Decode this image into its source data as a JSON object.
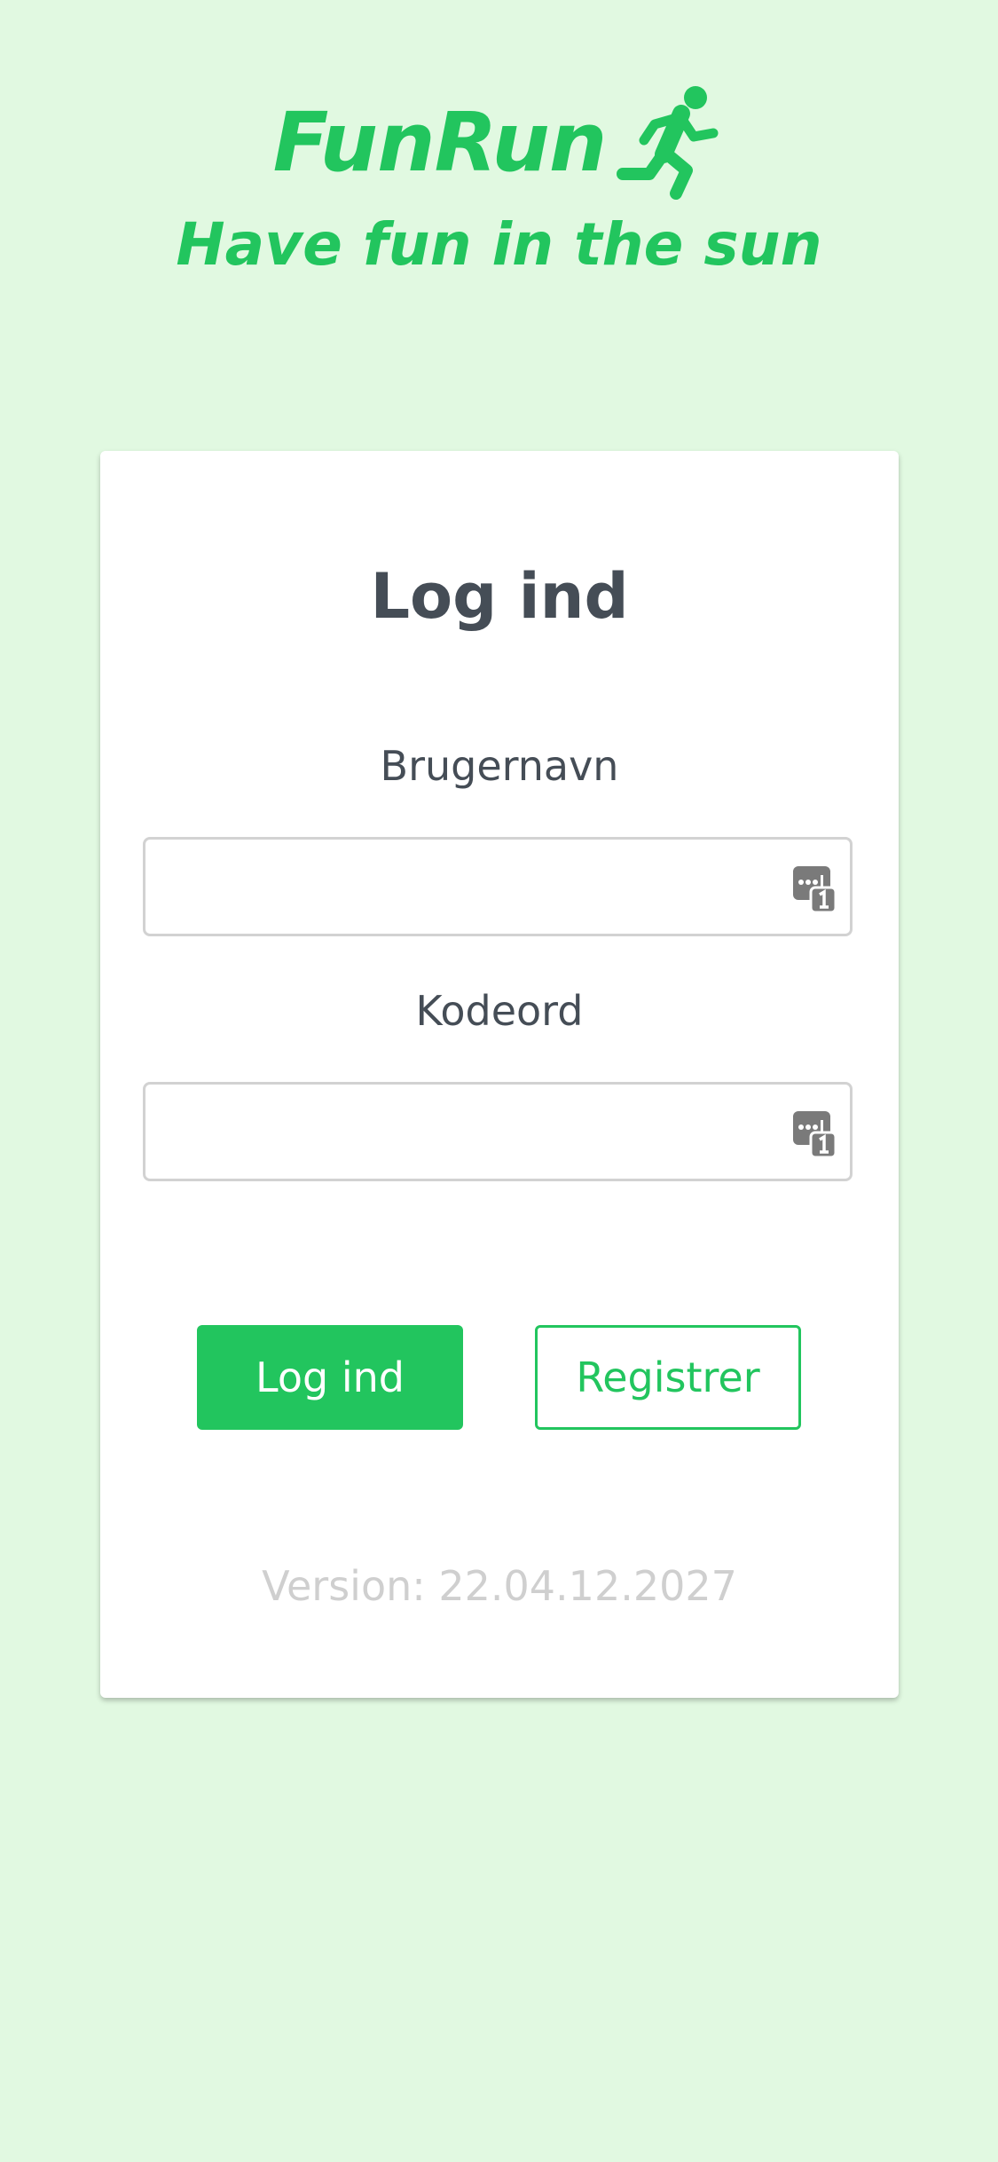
{
  "brand": {
    "name": "FunRun",
    "tagline": "Have fun in the sun",
    "color": "#22c55e",
    "icon": "running-person-icon"
  },
  "login_card": {
    "title": "Log ind",
    "username": {
      "label": "Brugernavn",
      "value": "",
      "placeholder": "",
      "icon": "password-manager-icon"
    },
    "password": {
      "label": "Kodeord",
      "value": "",
      "placeholder": "",
      "icon": "password-manager-icon"
    },
    "buttons": {
      "login_label": "Log ind",
      "register_label": "Registrer"
    },
    "version": "Version: 22.04.12.2027"
  },
  "colors": {
    "background": "#e1f9e1",
    "accent": "#22c55e",
    "text": "#454d56",
    "muted": "#cfcfcf"
  }
}
